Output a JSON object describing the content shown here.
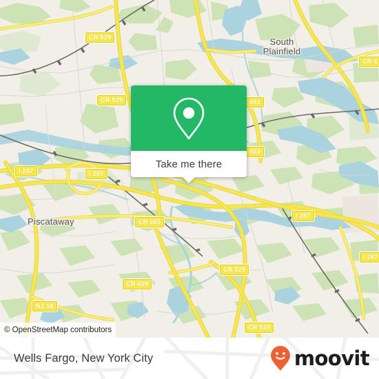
{
  "map": {
    "provider_attribution": "© OpenStreetMap contributors",
    "background_color": "#f2efe9",
    "water_color": "#aad3df",
    "park_color": "#cde3b5",
    "road_color": "#f7e84a",
    "places": [
      {
        "name": "South Plainfield",
        "line1": "South",
        "line2": "Plainfield"
      },
      {
        "name": "Piscataway",
        "line1": "Piscataway",
        "line2": ""
      }
    ],
    "shields": [
      {
        "label": "CR 529"
      },
      {
        "label": "CR 529"
      },
      {
        "label": "CR 529"
      },
      {
        "label": "CR 529"
      },
      {
        "label": "CR 6"
      },
      {
        "label": "603"
      },
      {
        "label": "603"
      },
      {
        "label": "I 287"
      },
      {
        "label": "I 287"
      },
      {
        "label": "I 287"
      },
      {
        "label": "I 287"
      },
      {
        "label": "CR 665"
      },
      {
        "label": "CR 609"
      },
      {
        "label": "NJ 18"
      }
    ]
  },
  "popup": {
    "icon": "map-pin-icon",
    "accent_color": "#22b866",
    "action_label": "Take me there"
  },
  "footer": {
    "title": "Wells Fargo, New York City",
    "brand_name": "moovit",
    "brand_color": "#ec6033",
    "brand_text_color": "#1d1d1d"
  }
}
